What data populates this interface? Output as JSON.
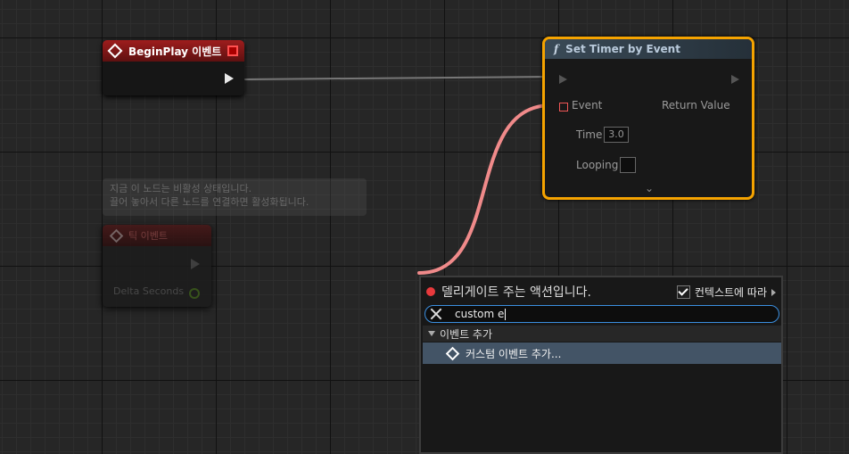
{
  "begin_play_node": {
    "title": "BeginPlay 이벤트"
  },
  "timer_node": {
    "title": "Set Timer by Event",
    "pin_event": "Event",
    "pin_return": "Return Value",
    "pin_time": "Time",
    "time_value": "3.0",
    "pin_looping": "Looping"
  },
  "ghost_tooltip": {
    "line1": "지금 이 노드는 비활성 상태입니다.",
    "line2": "끌어 놓아서 다른 노드를 연결하면 활성화됩니다."
  },
  "ghost_node": {
    "title": "틱 이벤트",
    "pin_delta": "Delta Seconds"
  },
  "action_menu": {
    "title": "델리게이트 주는 액션입니다.",
    "context_label": "컨텍스트에 따라",
    "context_checked": true,
    "search_value": "custom e",
    "category": "이벤트 추가",
    "item": "커스텀 이벤트 추가..."
  },
  "colors": {
    "selection_border": "#f5a300",
    "delegate_wire": "#f08a8a",
    "search_focus": "#3b8fe0",
    "highlight_row": "#435466"
  },
  "icons": [
    "event-diamond-icon",
    "function-icon",
    "chevron-down-icon",
    "clear-icon",
    "checkbox-icon",
    "expand-arrow-icon"
  ]
}
